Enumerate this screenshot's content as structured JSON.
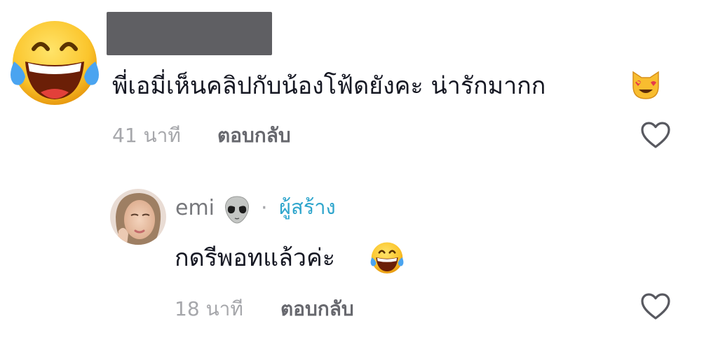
{
  "comment": {
    "avatar_icon": "face-with-tears-of-joy-icon",
    "text": "พี่เอมี่เห็นคลิปกับน้องโฟ้ดยังคะ น่ารักมากก",
    "trailing_icon": "smiling-cat-heart-eyes-icon",
    "time": "41 นาที",
    "reply_label": "ตอบกลับ",
    "like_icon": "heart-outline-icon"
  },
  "reply": {
    "avatar_icon": "user-avatar",
    "username": "emi",
    "username_icon": "alien-icon",
    "separator": "·",
    "creator_label": "ผู้สร้าง",
    "text": "กดรีพอทแล้วค่ะ",
    "trailing_icon": "face-with-tears-of-joy-icon",
    "time": "18 นาที",
    "reply_label": "ตอบกลับ",
    "like_icon": "heart-outline-icon"
  },
  "colors": {
    "text": "#161823",
    "meta": "#a6a7ab",
    "creator": "#2ea5cc",
    "redacted": "#5f5f63"
  }
}
